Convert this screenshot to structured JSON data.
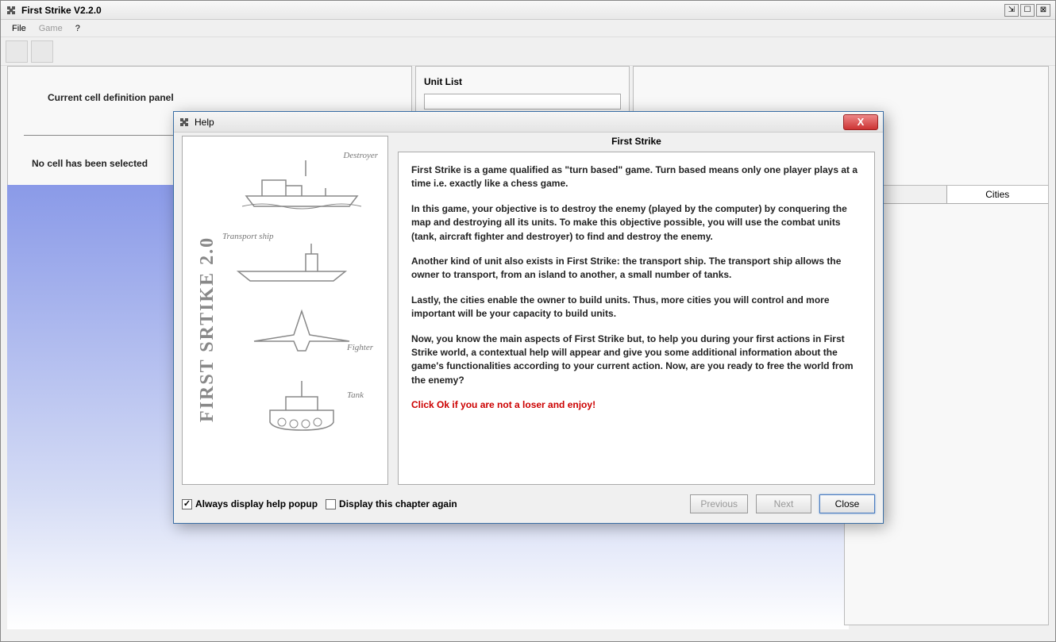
{
  "window": {
    "title": "First Strike V2.2.0"
  },
  "menu": {
    "file": "File",
    "game": "Game",
    "help": "?"
  },
  "panels": {
    "cell_title": "Current cell definition panel",
    "cell_status": "No cell has been selected",
    "unit_list_title": "Unit List"
  },
  "tabs": {
    "cities": "Cities"
  },
  "dialog": {
    "title": "Help",
    "heading": "First Strike",
    "p1": "First Strike is a game qualified as \"turn based\" game. Turn based means only one player plays at a time i.e. exactly like a chess game.",
    "p2": "In this game, your objective is to destroy the enemy (played by the computer) by conquering the map and destroying all its units. To make this objective possible, you will use the combat units (tank, aircraft fighter and destroyer) to find and destroy the enemy.",
    "p3": "Another kind of unit also exists in First Strike: the transport ship. The transport ship allows the owner to transport, from an island to another, a small number of tanks.",
    "p4": "Lastly, the cities enable the owner to build units. Thus, more cities you will control and more important will be your capacity to build units.",
    "p5": "Now, you know the main aspects of First Strike but, to help you during your first actions in First Strike world, a contextual help will appear and give you some additional information about the game's functionalities according to your current action. Now, are you ready to free the world from the enemy?",
    "p6": "Click Ok if you are not a loser and enjoy!",
    "chk_always": "Always display help popup",
    "chk_again": "Display this chapter again",
    "btn_prev": "Previous",
    "btn_next": "Next",
    "btn_close": "Close",
    "sketch_title": "FIRST SRTIKE 2.0",
    "sk_destroyer": "Destroyer",
    "sk_transport": "Transport ship",
    "sk_fighter": "Fighter",
    "sk_tank": "Tank"
  }
}
